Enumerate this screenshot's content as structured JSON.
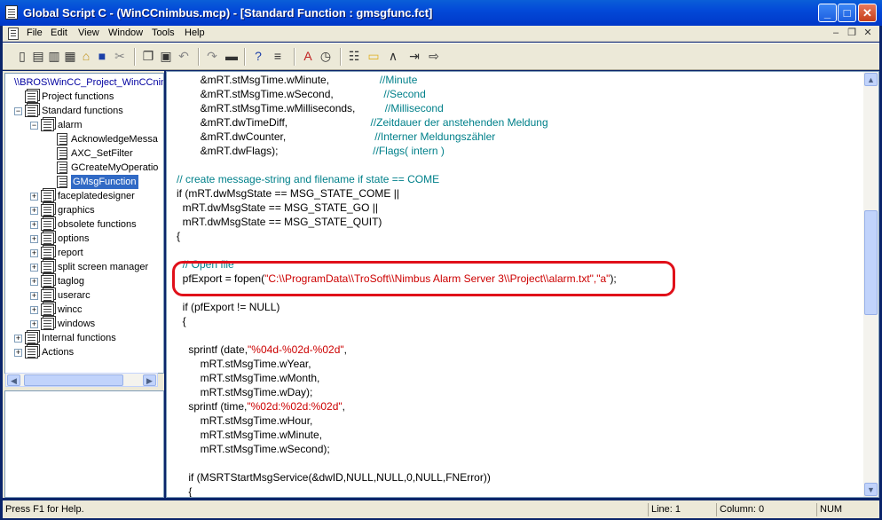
{
  "window": {
    "title": "Global Script C - (WinCCnimbus.mcp) - [Standard Function : gmsgfunc.fct]",
    "minimize_label": "_",
    "maximize_label": "□",
    "close_label": "✕"
  },
  "menu": [
    "File",
    "Edit",
    "View",
    "Window",
    "Tools",
    "Help"
  ],
  "mdi_controls": [
    "–",
    "❐",
    "✕"
  ],
  "toolbar": {
    "icons": [
      "new-icon",
      "open-icon",
      "open-all-icon",
      "edit-icon",
      "folder-open-icon",
      "save-icon",
      "cut-icon",
      "copy-icon",
      "paste-icon",
      "undo-icon",
      "redo-icon",
      "compile-icon",
      "help-pointer-icon",
      "properties-icon",
      "font-color-icon",
      "clock-icon",
      "function-list-icon",
      "folder-icon",
      "compass-icon",
      "import-icon",
      "export-icon"
    ]
  },
  "tree": {
    "root": "\\\\BROS\\WinCC_Project_WinCCnim",
    "nodes": [
      {
        "label": "Project functions",
        "depth": 1,
        "expander": "",
        "selected": false
      },
      {
        "label": "Standard functions",
        "depth": 1,
        "expander": "−",
        "selected": false
      },
      {
        "label": "alarm",
        "depth": 2,
        "expander": "−",
        "selected": false
      },
      {
        "label": "AcknowledgeMessa",
        "depth": 3,
        "expander": "",
        "selected": false
      },
      {
        "label": "AXC_SetFilter",
        "depth": 3,
        "expander": "",
        "selected": false
      },
      {
        "label": "GCreateMyOperatio",
        "depth": 3,
        "expander": "",
        "selected": false
      },
      {
        "label": "GMsgFunction",
        "depth": 3,
        "expander": "",
        "selected": true
      },
      {
        "label": "faceplatedesigner",
        "depth": 2,
        "expander": "+",
        "selected": false
      },
      {
        "label": "graphics",
        "depth": 2,
        "expander": "+",
        "selected": false
      },
      {
        "label": "obsolete functions",
        "depth": 2,
        "expander": "+",
        "selected": false
      },
      {
        "label": "options",
        "depth": 2,
        "expander": "+",
        "selected": false
      },
      {
        "label": "report",
        "depth": 2,
        "expander": "+",
        "selected": false
      },
      {
        "label": "split screen manager",
        "depth": 2,
        "expander": "+",
        "selected": false
      },
      {
        "label": "taglog",
        "depth": 2,
        "expander": "+",
        "selected": false
      },
      {
        "label": "userarc",
        "depth": 2,
        "expander": "+",
        "selected": false
      },
      {
        "label": "wincc",
        "depth": 2,
        "expander": "+",
        "selected": false
      },
      {
        "label": "windows",
        "depth": 2,
        "expander": "+",
        "selected": false
      },
      {
        "label": "Internal functions",
        "depth": 1,
        "expander": "+",
        "selected": false
      },
      {
        "label": "Actions",
        "depth": 1,
        "expander": "+",
        "selected": false
      }
    ]
  },
  "code_lines": [
    [
      {
        "t": "        &mRT.stMsgTime.wMinute,                 "
      },
      {
        "t": "//Minute",
        "c": "cm"
      }
    ],
    [
      {
        "t": "        &mRT.stMsgTime.wSecond,                 "
      },
      {
        "t": "//Second",
        "c": "cm"
      }
    ],
    [
      {
        "t": "        &mRT.stMsgTime.wMilliseconds,          "
      },
      {
        "t": "//Millisecond",
        "c": "cm"
      }
    ],
    [
      {
        "t": "        &mRT.dwTimeDiff,                            "
      },
      {
        "t": "//Zeitdauer der anstehenden Meldung",
        "c": "cm"
      }
    ],
    [
      {
        "t": "        &mRT.dwCounter,                              "
      },
      {
        "t": "//Interner Meldungszähler",
        "c": "cm"
      }
    ],
    [
      {
        "t": "        &mRT.dwFlags);                                "
      },
      {
        "t": "//Flags( intern )",
        "c": "cm"
      }
    ],
    [
      {
        "t": ""
      }
    ],
    [
      {
        "t": "// create message-string and filename if state == COME",
        "c": "cm"
      }
    ],
    [
      {
        "t": "if (mRT.dwMsgState == MSG_STATE_COME ||"
      }
    ],
    [
      {
        "t": "  mRT.dwMsgState == MSG_STATE_GO ||"
      }
    ],
    [
      {
        "t": "  mRT.dwMsgState == MSG_STATE_QUIT)"
      }
    ],
    [
      {
        "t": "{"
      }
    ],
    [
      {
        "t": ""
      }
    ],
    [
      {
        "t": "  // Open file",
        "c": "cm"
      }
    ],
    [
      {
        "t": "  pfExport = fopen("
      },
      {
        "t": "\"C:\\\\ProgramData\\\\TroSoft\\\\Nimbus Alarm Server 3\\\\Project\\\\alarm.txt\",\"a\"",
        "c": "st"
      },
      {
        "t": ");"
      }
    ],
    [
      {
        "t": ""
      }
    ],
    [
      {
        "t": "  if (pfExport != NULL)"
      }
    ],
    [
      {
        "t": "  {"
      }
    ],
    [
      {
        "t": ""
      }
    ],
    [
      {
        "t": "    sprintf (date,"
      },
      {
        "t": "\"%04d-%02d-%02d\"",
        "c": "st"
      },
      {
        "t": ","
      }
    ],
    [
      {
        "t": "        mRT.stMsgTime.wYear,"
      }
    ],
    [
      {
        "t": "        mRT.stMsgTime.wMonth,"
      }
    ],
    [
      {
        "t": "        mRT.stMsgTime.wDay);"
      }
    ],
    [
      {
        "t": "    sprintf (time,"
      },
      {
        "t": "\"%02d:%02d:%02d\"",
        "c": "st"
      },
      {
        "t": ","
      }
    ],
    [
      {
        "t": "        mRT.stMsgTime.wHour,"
      }
    ],
    [
      {
        "t": "        mRT.stMsgTime.wMinute,"
      }
    ],
    [
      {
        "t": "        mRT.stMsgTime.wSecond);"
      }
    ],
    [
      {
        "t": ""
      }
    ],
    [
      {
        "t": "    if (MSRTStartMsgService(&dwID,NULL,NULL,0,NULL,FNError))"
      }
    ],
    [
      {
        "t": "    {"
      }
    ]
  ],
  "status": {
    "help": "Press F1 for Help.",
    "line": "Line: 1",
    "column": "Column: 0",
    "num": "NUM"
  },
  "colors": {
    "comment": "#00808a",
    "string": "#cc0000",
    "highlight": "#e0101a",
    "selection": "#316ac5"
  }
}
